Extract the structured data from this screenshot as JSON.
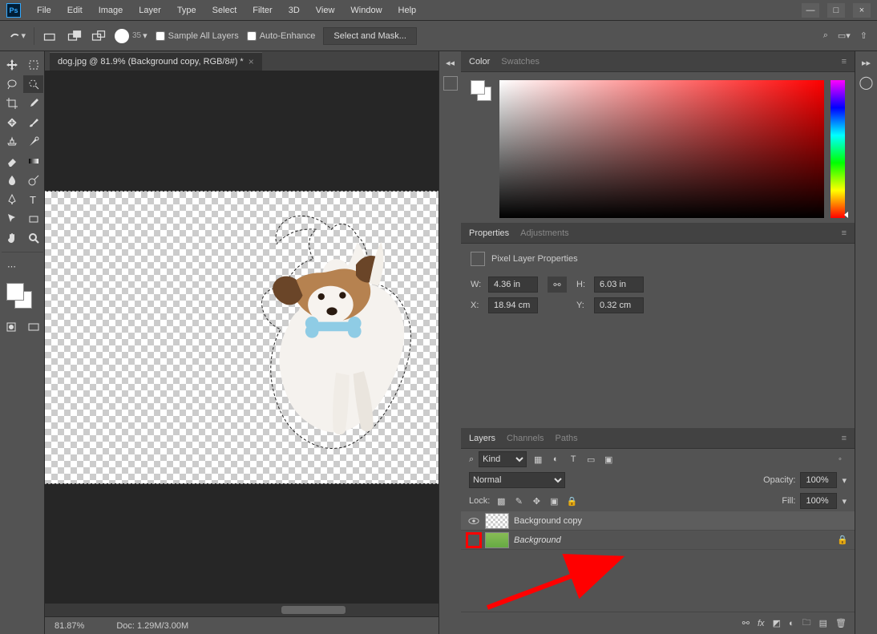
{
  "menu": {
    "items": [
      "File",
      "Edit",
      "Image",
      "Layer",
      "Type",
      "Select",
      "Filter",
      "3D",
      "View",
      "Window",
      "Help"
    ]
  },
  "optbar": {
    "brush_size": "35",
    "sample_all": "Sample All Layers",
    "auto_enhance": "Auto-Enhance",
    "select_mask": "Select and Mask..."
  },
  "doc": {
    "tab_title": "dog.jpg @ 81.9% (Background copy, RGB/8#) *",
    "zoom": "81.87%",
    "docsize": "Doc: 1.29M/3.00M"
  },
  "panels": {
    "color": {
      "tab1": "Color",
      "tab2": "Swatches"
    },
    "properties": {
      "tab1": "Properties",
      "tab2": "Adjustments",
      "title": "Pixel Layer Properties",
      "w": "4.36 in",
      "h": "6.03 in",
      "x": "18.94 cm",
      "y": "0.32 cm"
    },
    "layers": {
      "tab1": "Layers",
      "tab2": "Channels",
      "tab3": "Paths",
      "kind_label": "Kind",
      "blend": "Normal",
      "opacity_label": "Opacity:",
      "opacity": "100%",
      "lock_label": "Lock:",
      "fill_label": "Fill:",
      "fill": "100%",
      "rows": [
        {
          "name": "Background copy",
          "visible": true,
          "selected": true,
          "locked": false
        },
        {
          "name": "Background",
          "visible": false,
          "selected": false,
          "locked": true
        }
      ]
    }
  }
}
